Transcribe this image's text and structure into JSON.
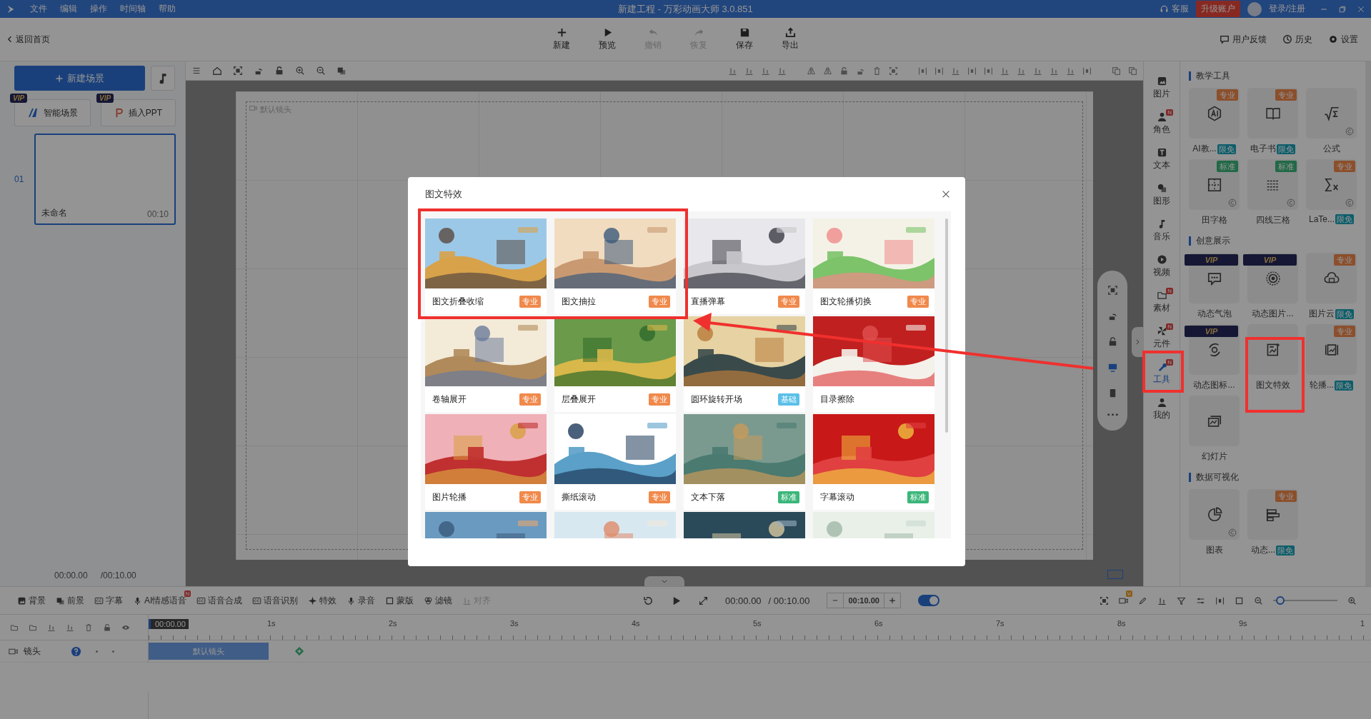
{
  "menu": [
    "文件",
    "编辑",
    "操作",
    "时间轴",
    "帮助"
  ],
  "window": {
    "title": "新建工程 - 万彩动画大师 3.0.851"
  },
  "title_actions": {
    "service": "客服",
    "upgrade": "升级账户",
    "login": "登录/注册"
  },
  "toolbar": {
    "back": "返回首页",
    "actions": [
      {
        "label": "新建",
        "disabled": false
      },
      {
        "label": "预览",
        "disabled": false
      },
      {
        "label": "撤销",
        "disabled": true
      },
      {
        "label": "恢复",
        "disabled": true
      },
      {
        "label": "保存",
        "disabled": false
      },
      {
        "label": "导出",
        "disabled": false
      }
    ],
    "right": [
      "用户反馈",
      "历史",
      "设置"
    ]
  },
  "scenes_panel": {
    "new_scene": "新建场景",
    "smart": {
      "label": "智能场景",
      "badge": "VIP"
    },
    "ppt": {
      "label": "插入PPT",
      "badge": "VIP"
    },
    "scenes": [
      {
        "index": "01",
        "name": "未命名",
        "duration": "00:10",
        "selected": true
      }
    ],
    "time": "00:00.00",
    "total": "/00:10.00"
  },
  "canvas": {
    "camera_label": "默认镜头"
  },
  "side_tabs": [
    {
      "label": "图片",
      "selected": false
    },
    {
      "label": "角色",
      "badge": "N",
      "selected": false
    },
    {
      "label": "文本",
      "selected": false
    },
    {
      "label": "图形",
      "selected": false
    },
    {
      "label": "音乐",
      "selected": false
    },
    {
      "label": "视频",
      "selected": false
    },
    {
      "label": "素材",
      "badge": "N",
      "selected": false
    },
    {
      "label": "元件",
      "badge": "N",
      "selected": false
    },
    {
      "label": "工具",
      "badge": "N",
      "selected": true
    },
    {
      "label": "我的",
      "selected": false
    }
  ],
  "tools_panel": {
    "sections": [
      {
        "title": "教学工具",
        "items": [
          {
            "label": "AI教...",
            "tier": "专业",
            "tag": "限免"
          },
          {
            "label": "电子书",
            "tier": "专业",
            "tag": "限免"
          },
          {
            "label": "公式",
            "copyright": true
          },
          {
            "label": "田字格",
            "tier": "标准",
            "copyright": true
          },
          {
            "label": "四线三格",
            "tier": "标准",
            "copyright": true
          },
          {
            "label": "LaTe...",
            "tier": "专业",
            "tag": "限免",
            "copyright": true
          }
        ]
      },
      {
        "title": "创意展示",
        "items": [
          {
            "label": "动态气泡",
            "tier": "VIP"
          },
          {
            "label": "动态图片...",
            "tier": "VIP"
          },
          {
            "label": "图片云",
            "tier": "专业",
            "tag": "限免"
          },
          {
            "label": "动态图标...",
            "tier": "VIP"
          },
          {
            "label": "图文特效"
          },
          {
            "label": "轮播...",
            "tier": "专业",
            "tag": "限免"
          },
          {
            "label": "幻灯片"
          }
        ]
      },
      {
        "title": "数据可视化",
        "items": [
          {
            "label": "图表",
            "copyright": true
          },
          {
            "label": "动态...",
            "tier": "专业",
            "tag": "限免"
          }
        ]
      }
    ]
  },
  "timeline": {
    "tools": [
      {
        "label": "背景",
        "disabled": false
      },
      {
        "label": "前景",
        "disabled": false
      },
      {
        "label": "字幕",
        "disabled": false
      },
      {
        "label": "AI情感语音",
        "badge": "N",
        "disabled": false
      },
      {
        "label": "语音合成",
        "disabled": false
      },
      {
        "label": "语音识别",
        "disabled": false
      },
      {
        "label": "特效",
        "disabled": false
      },
      {
        "label": "录音",
        "disabled": false
      },
      {
        "label": "蒙版",
        "disabled": false
      },
      {
        "label": "滤镜",
        "disabled": false
      },
      {
        "label": "对齐",
        "disabled": true
      }
    ],
    "time": "00:00.00",
    "total": "/ 00:10.00",
    "duration": "00:10.00",
    "loop_on": true,
    "camera_badge": "V",
    "zoom": {
      "level": 0.05
    },
    "playhead": "00:00.00",
    "ruler": [
      "1s",
      "2s",
      "3s",
      "4s",
      "5s",
      "6s",
      "7s",
      "8s",
      "9s",
      "1"
    ],
    "track": {
      "label": "镜头",
      "clip": "默认镜头"
    }
  },
  "dialog": {
    "title": "图文特效",
    "cards": [
      {
        "label": "图文折叠收缩",
        "tier": "专业"
      },
      {
        "label": "图文抽拉",
        "tier": "专业"
      },
      {
        "label": "直播弹幕",
        "tier": "专业"
      },
      {
        "label": "图文轮播切换",
        "tier": "专业"
      },
      {
        "label": "卷轴展开",
        "tier": "专业"
      },
      {
        "label": "层叠展开",
        "tier": "专业"
      },
      {
        "label": "圆环旋转开场",
        "tier": "基础"
      },
      {
        "label": "目录擦除"
      },
      {
        "label": "图片轮播",
        "tier": "专业"
      },
      {
        "label": "撕纸滚动",
        "tier": "专业"
      },
      {
        "label": "文本下落",
        "tier": "标准"
      },
      {
        "label": "字幕滚动",
        "tier": "标准"
      }
    ],
    "more_below": true
  }
}
